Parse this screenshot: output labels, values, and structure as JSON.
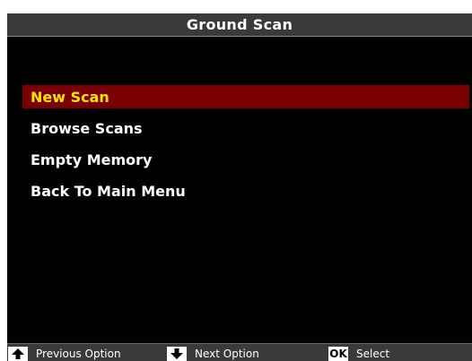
{
  "header": {
    "title": "Ground Scan"
  },
  "menu": {
    "items": [
      {
        "label": "New Scan",
        "selected": true
      },
      {
        "label": "Browse Scans",
        "selected": false
      },
      {
        "label": "Empty Memory",
        "selected": false
      },
      {
        "label": "Back To Main Menu",
        "selected": false
      }
    ]
  },
  "footer": {
    "previous": {
      "icon": "arrow-up-icon",
      "label": "Previous Option"
    },
    "next": {
      "icon": "arrow-down-icon",
      "label": "Next Option"
    },
    "select": {
      "key": "OK",
      "label": "Select"
    }
  },
  "colors": {
    "background": "#000000",
    "title_bar": "#3a3a3a",
    "selected_bg": "#7a0000",
    "selected_text": "#ffe600",
    "text": "#ffffff"
  }
}
